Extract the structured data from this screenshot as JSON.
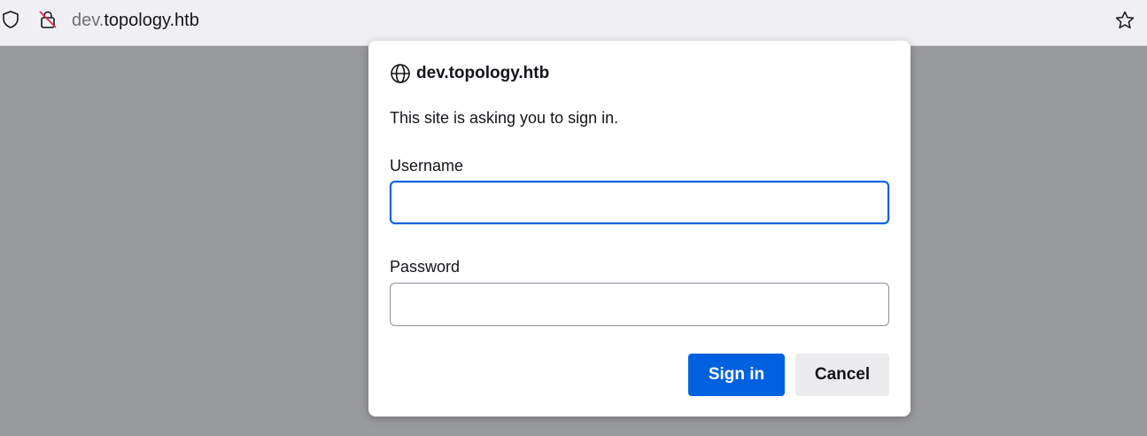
{
  "urlbar": {
    "url_prefix": "dev.",
    "url_main": "topology.htb",
    "icons": {
      "shield": "shield-icon",
      "lock": "insecure-lock-icon",
      "star": "bookmark-star-icon"
    }
  },
  "dialog": {
    "site": "dev.topology.htb",
    "message": "This site is asking you to sign in.",
    "username_label": "Username",
    "username_value": "",
    "password_label": "Password",
    "password_value": "",
    "signin_label": "Sign in",
    "cancel_label": "Cancel"
  },
  "colors": {
    "accent": "#0061e0",
    "overlay": "#999a9c",
    "insecure_strike": "#e22850"
  }
}
